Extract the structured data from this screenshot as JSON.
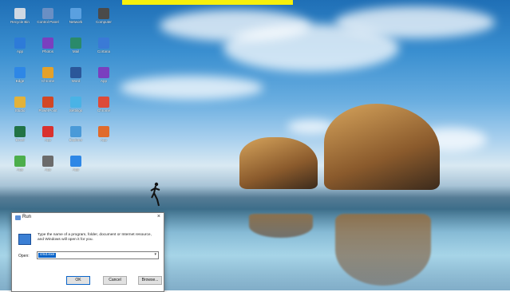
{
  "desktop": {
    "icons": [
      {
        "label": "Recycle Bin",
        "color": "#cfd8e3"
      },
      {
        "label": "Control Panel",
        "color": "#6a8fc4"
      },
      {
        "label": "Network",
        "color": "#5aa0e0"
      },
      {
        "label": "Computer",
        "color": "#4a4a4a"
      },
      {
        "label": "App",
        "color": "#2d7bd8"
      },
      {
        "label": "Photos",
        "color": "#7a3fbf"
      },
      {
        "label": "Mail",
        "color": "#2a8a6a"
      },
      {
        "label": "Cortana",
        "color": "#3a7ad6"
      },
      {
        "label": "Edge",
        "color": "#2e87e6"
      },
      {
        "label": "Chrome",
        "color": "#e4a12a"
      },
      {
        "label": "Word",
        "color": "#2b579a"
      },
      {
        "label": "App",
        "color": "#7a3fbf"
      },
      {
        "label": "Studio",
        "color": "#e2b23a"
      },
      {
        "label": "PowerPoint",
        "color": "#d24726"
      },
      {
        "label": "Settings",
        "color": "#4ab3e6"
      },
      {
        "label": "Chrome",
        "color": "#dd4b39"
      },
      {
        "label": "Excel",
        "color": "#217346"
      },
      {
        "label": "App",
        "color": "#d9312f"
      },
      {
        "label": "Explorer",
        "color": "#4a9ad8"
      },
      {
        "label": "App",
        "color": "#e06b2c"
      },
      {
        "label": "App",
        "color": "#4cae4c"
      },
      {
        "label": "App",
        "color": "#6b6b6b"
      },
      {
        "label": "App",
        "color": "#2e87e6"
      }
    ]
  },
  "run_dialog": {
    "title": "Run",
    "close_glyph": "×",
    "description": "Type the name of a program, folder, document or Internet resource, and Windows will open it for you.",
    "open_label": "Open:",
    "open_value": "cmd.exe",
    "ok_label": "OK",
    "cancel_label": "Cancel",
    "browse_label": "Browse..."
  }
}
